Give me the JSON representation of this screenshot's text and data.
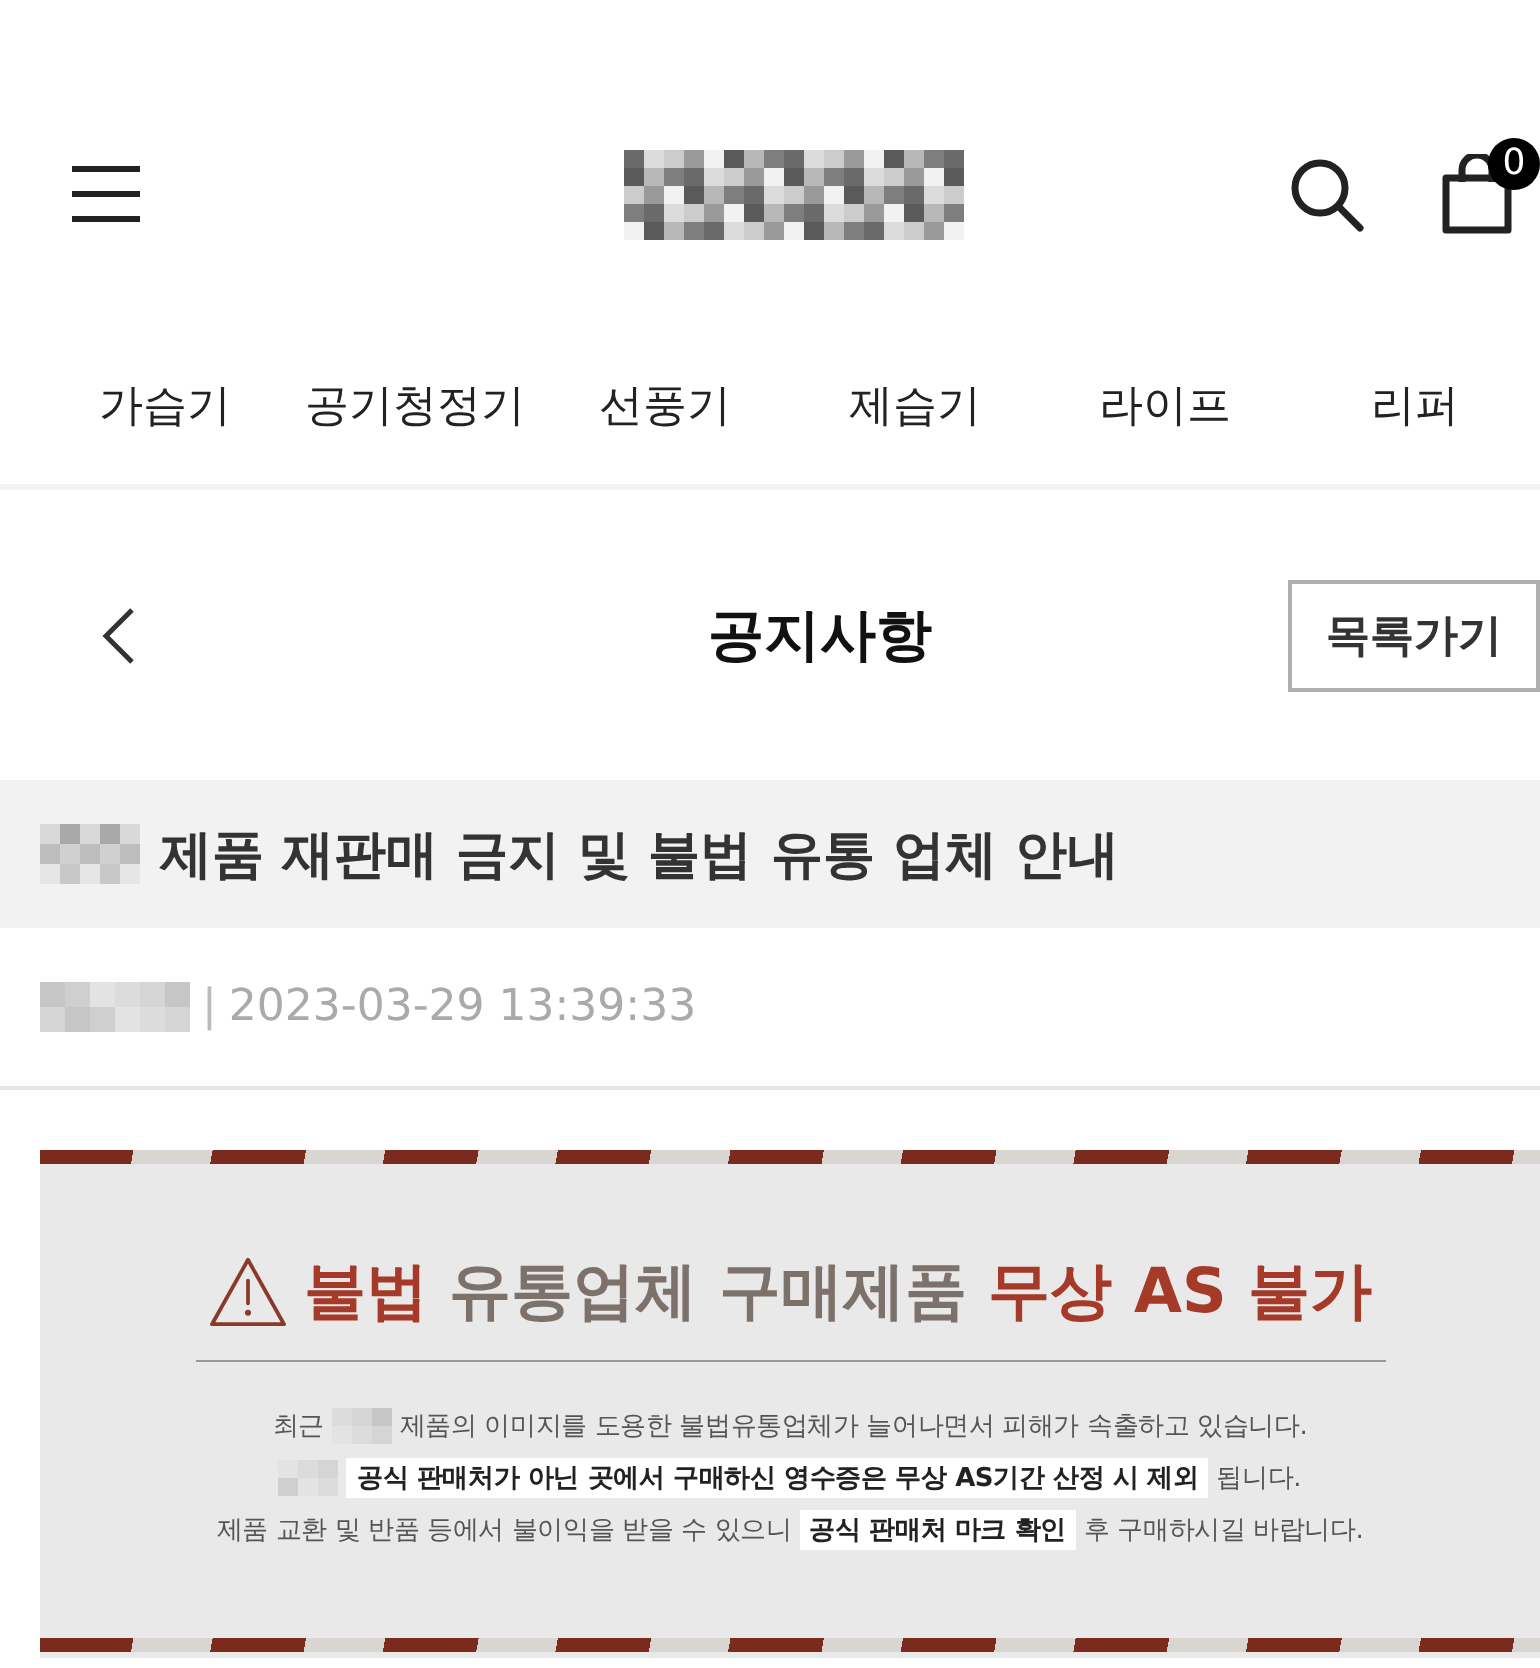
{
  "header": {
    "cart_count": "0"
  },
  "nav": [
    {
      "label": "가습기"
    },
    {
      "label": "공기청정기"
    },
    {
      "label": "선풍기"
    },
    {
      "label": "제습기"
    },
    {
      "label": "라이프"
    },
    {
      "label": "리퍼"
    }
  ],
  "page_header": {
    "title": "공지사항",
    "button": "목록가기"
  },
  "notice": {
    "title": [
      {
        "kind": "redacted"
      },
      {
        "kind": "text",
        "text": "제품 재판매 금지 및 불법 유통 업체 안내"
      }
    ],
    "meta": [
      {
        "kind": "redacted"
      },
      {
        "kind": "separator",
        "text": "|"
      },
      {
        "kind": "text",
        "text": "2023-03-29 13:39:33"
      }
    ],
    "banner": {
      "heading": [
        {
          "kind": "highlight",
          "text": "불법"
        },
        {
          "kind": "plain",
          "text": " 유통업체 구매제품 "
        },
        {
          "kind": "highlight",
          "text": "무상 AS 불가"
        }
      ],
      "lines": [
        [
          {
            "kind": "text",
            "text": "최근"
          },
          {
            "kind": "redacted"
          },
          {
            "kind": "text",
            "text": "제품의 이미지를 도용한 불법유통업체가 늘어나면서 피해가 속출하고 있습니다."
          }
        ],
        [
          {
            "kind": "redacted"
          },
          {
            "kind": "marked",
            "text": "공식 판매처가 아닌 곳에서 구매하신 영수증은 무상 AS기간 산정 시 제외"
          },
          {
            "kind": "text",
            "text": "됩니다."
          }
        ],
        [
          {
            "kind": "text",
            "text": "제품 교환 및 반품 등에서 불이익을 받을 수 있으니"
          },
          {
            "kind": "marked",
            "text": "공식 판매처 마크 확인"
          },
          {
            "kind": "text",
            "text": "후 구매하시길 바랍니다."
          }
        ]
      ]
    }
  }
}
